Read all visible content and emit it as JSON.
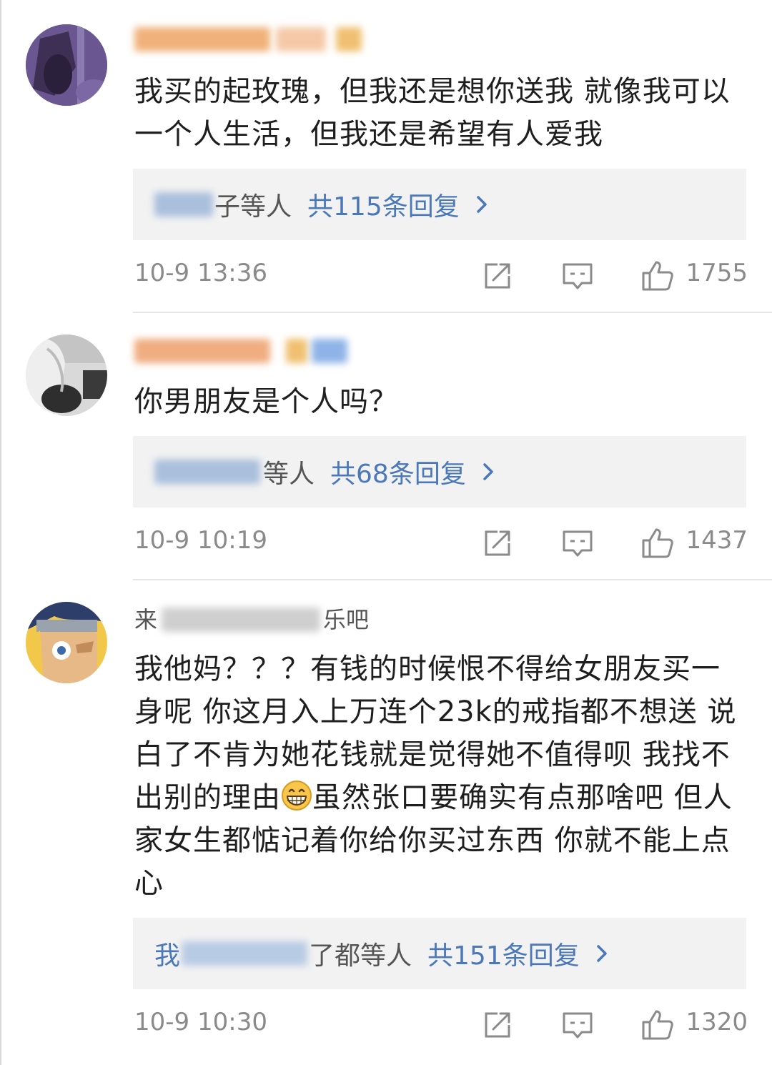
{
  "comments": [
    {
      "username_visible": "",
      "text": "我买的起玫瑰，但我还是想你送我  就像我可以一个人生活，但我还是希望有人爱我",
      "reply_names_suffix": "子等人",
      "reply_count_label": "共115条回复",
      "time": "10-9 13:36",
      "likes": "1755"
    },
    {
      "username_visible": "",
      "text": "你男朋友是个人吗？",
      "reply_names_suffix": "等人",
      "reply_count_label": "共68条回复",
      "time": "10-9 10:19",
      "likes": "1437"
    },
    {
      "username_prefix": "来",
      "username_suffix": "乐吧",
      "text_part1": "我他妈？？？有钱的时候恨不得给女朋友买一身呢 你这月入上万连个23k的戒指都不想送 说白了不肯为她花钱就是觉得她不值得呗 我找不出别的理由",
      "text_part2": "虽然张口要确实有点那啥吧 但人家女生都惦记着你给你买过东西 你就不能上点心",
      "reply_names_prefix": "我",
      "reply_names_suffix": "了都等人",
      "reply_count_label": "共151条回复",
      "time": "10-9 10:30",
      "likes": "1320"
    }
  ],
  "colors": {
    "link": "#4a78b8",
    "meta": "#8a8a8a",
    "reply_bg": "#f2f2f2",
    "username_orange": "#e08a3c"
  },
  "icons": [
    "repost-icon",
    "comment-icon",
    "like-thumb-icon",
    "chevron-right-icon",
    "grinning-emoji-icon"
  ]
}
